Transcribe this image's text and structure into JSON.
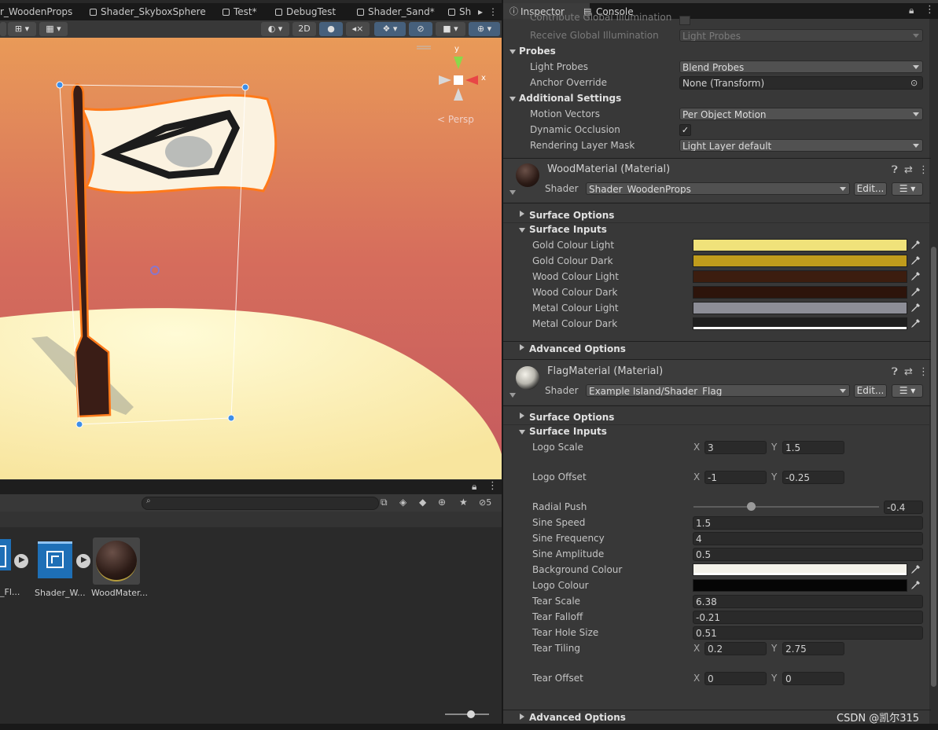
{
  "scene_tabs": [
    "r_WoodenProps",
    "Shader_SkyboxSphere",
    "Test*",
    "DebugTest",
    "Shader_Sand*",
    "Sh"
  ],
  "scene_toolbar": {
    "two_d": "2D",
    "gizmo_label": "Persp",
    "axis_y": "y",
    "axis_x": "x"
  },
  "project": {
    "search_placeholder": "",
    "hidden_count": "5",
    "assets": [
      {
        "label": "_Fl..."
      },
      {
        "label": "Shader_W..."
      },
      {
        "label": "WoodMater..."
      }
    ]
  },
  "inspector": {
    "tabs": [
      {
        "label": "Inspector"
      },
      {
        "label": "Console"
      }
    ],
    "lighting": {
      "contribute_gi": "Contribute Global Illumination",
      "receive_gi_label": "Receive Global Illumination",
      "receive_gi_value": "Light Probes"
    },
    "probes": {
      "header": "Probes",
      "light_probes_label": "Light Probes",
      "light_probes_value": "Blend Probes",
      "anchor_label": "Anchor Override",
      "anchor_value": "None (Transform)"
    },
    "additional": {
      "header": "Additional Settings",
      "motion_label": "Motion Vectors",
      "motion_value": "Per Object Motion",
      "occlusion_label": "Dynamic Occlusion",
      "occlusion_checked": true,
      "layer_label": "Rendering Layer Mask",
      "layer_value": "Light Layer default"
    },
    "wood_material": {
      "title": "WoodMaterial (Material)",
      "shader_label": "Shader",
      "shader_value": "Shader_WoodenProps",
      "edit": "Edit...",
      "surface_options": "Surface Options",
      "surface_inputs": "Surface Inputs",
      "advanced": "Advanced Options",
      "colors": [
        {
          "label": "Gold Colour Light",
          "color": "#f0e27a"
        },
        {
          "label": "Gold Colour Dark",
          "color": "#c09c1c"
        },
        {
          "label": "Wood Colour Light",
          "color": "#3c1d0f"
        },
        {
          "label": "Wood Colour Dark",
          "color": "#2d140b"
        },
        {
          "label": "Metal Colour Light",
          "color": "#8d8e97"
        },
        {
          "label": "Metal Colour Dark",
          "color": "#1f1f1f"
        }
      ]
    },
    "flag_material": {
      "title": "FlagMaterial (Material)",
      "shader_label": "Shader",
      "shader_value": "Example Island/Shader_Flag",
      "edit": "Edit...",
      "surface_options": "Surface Options",
      "surface_inputs": "Surface Inputs",
      "advanced": "Advanced Options",
      "logo_scale": {
        "label": "Logo Scale",
        "x": "3",
        "y": "1.5"
      },
      "logo_offset": {
        "label": "Logo Offset",
        "x": "-1",
        "y": "-0.25"
      },
      "radial_push": {
        "label": "Radial Push",
        "value": "-0.4",
        "fraction": 0.31
      },
      "sine_speed": {
        "label": "Sine Speed",
        "value": "1.5"
      },
      "sine_frequency": {
        "label": "Sine Frequency",
        "value": "4"
      },
      "sine_amplitude": {
        "label": "Sine Amplitude",
        "value": "0.5"
      },
      "background_colour": {
        "label": "Background Colour",
        "color": "#f4f2ea"
      },
      "logo_colour": {
        "label": "Logo Colour",
        "color": "#050505"
      },
      "tear_scale": {
        "label": "Tear Scale",
        "value": "6.38"
      },
      "tear_falloff": {
        "label": "Tear Falloff",
        "value": "-0.21"
      },
      "tear_hole_size": {
        "label": "Tear Hole Size",
        "value": "0.51"
      },
      "tear_tiling": {
        "label": "Tear Tiling",
        "x": "0.2",
        "y": "2.75"
      },
      "tear_offset": {
        "label": "Tear Offset",
        "x": "0",
        "y": "0"
      }
    },
    "axis_x": "X",
    "axis_y": "Y"
  },
  "watermark": "CSDN @凯尔315"
}
